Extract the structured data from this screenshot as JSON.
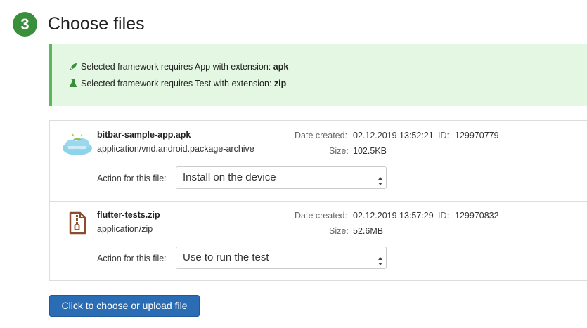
{
  "header": {
    "step_number": "3",
    "title": "Choose files"
  },
  "notice": {
    "app_requirement_prefix": "Selected framework requires App with extension:",
    "app_extension": "apk",
    "test_requirement_prefix": "Selected framework requires Test with extension:",
    "test_extension": "zip"
  },
  "files": [
    {
      "name": "bitbar-sample-app.apk",
      "mime": "application/vnd.android.package-archive",
      "date_label": "Date created:",
      "date": "02.12.2019 13:52:21",
      "id_label": "ID:",
      "id": "129970779",
      "size_label": "Size:",
      "size": "102.5KB",
      "action_label": "Action for this file:",
      "action": "Install on the device",
      "icon": "android-app-icon"
    },
    {
      "name": "flutter-tests.zip",
      "mime": "application/zip",
      "date_label": "Date created:",
      "date": "02.12.2019 13:57:29",
      "id_label": "ID:",
      "id": "129970832",
      "size_label": "Size:",
      "size": "52.6MB",
      "action_label": "Action for this file:",
      "action": "Use to run the test",
      "icon": "zip-file-icon"
    }
  ],
  "upload_button": {
    "label": "Click to choose or upload file"
  },
  "colors": {
    "step_badge": "#3a8f3c",
    "notice_bg": "#e3f7e2",
    "notice_border": "#5cb85c",
    "button": "#2a6db5"
  }
}
